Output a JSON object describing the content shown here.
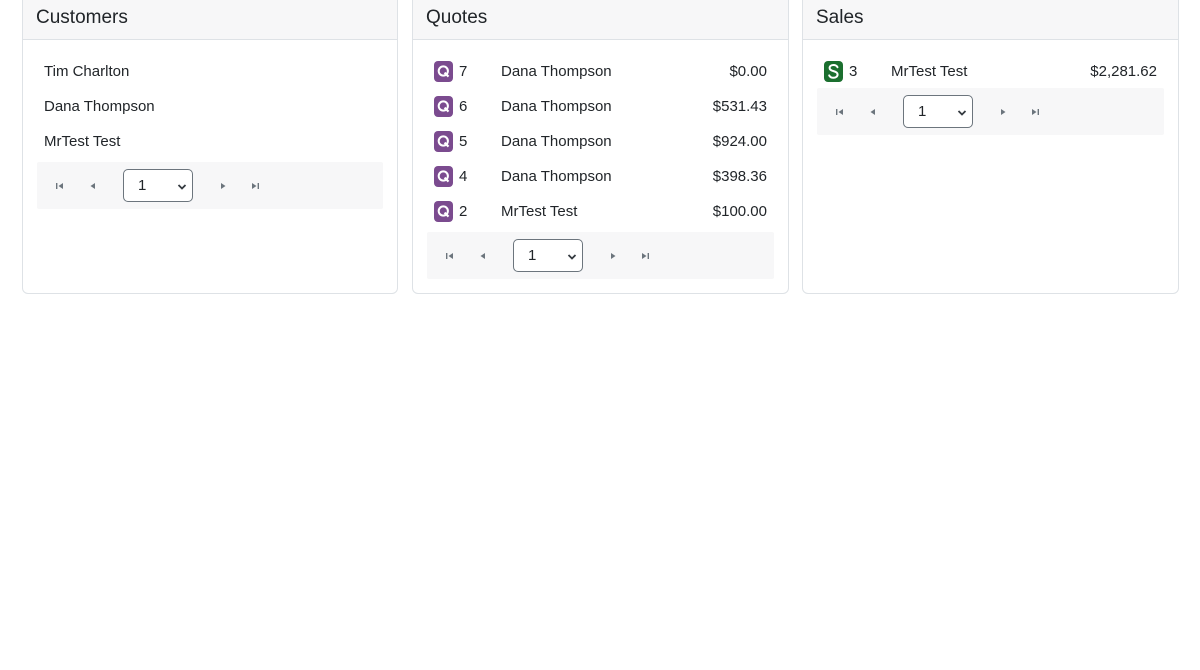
{
  "customers": {
    "title": "Customers",
    "items": [
      "Tim Charlton",
      "Dana Thompson",
      "MrTest Test"
    ],
    "page": "1"
  },
  "quotes": {
    "title": "Quotes",
    "items": [
      {
        "id": "7",
        "customer": "Dana Thompson",
        "amount": "$0.00"
      },
      {
        "id": "6",
        "customer": "Dana Thompson",
        "amount": "$531.43"
      },
      {
        "id": "5",
        "customer": "Dana Thompson",
        "amount": "$924.00"
      },
      {
        "id": "4",
        "customer": "Dana Thompson",
        "amount": "$398.36"
      },
      {
        "id": "2",
        "customer": "MrTest Test",
        "amount": "$100.00"
      }
    ],
    "page": "1"
  },
  "sales": {
    "title": "Sales",
    "items": [
      {
        "id": "3",
        "customer": "MrTest Test",
        "amount": "$2,281.62"
      }
    ],
    "page": "1"
  },
  "colors": {
    "quote_badge": "#7b4b8f",
    "sale_badge": "#1b6f2f",
    "header_bg": "#f7f7f8"
  },
  "icons": {
    "quote_badge": "q-badge-icon",
    "sale_badge": "s-badge-icon",
    "first": "first-page-icon",
    "prev": "previous-page-icon",
    "next": "next-page-icon",
    "last": "last-page-icon",
    "dropdown": "chevron-down-icon"
  }
}
